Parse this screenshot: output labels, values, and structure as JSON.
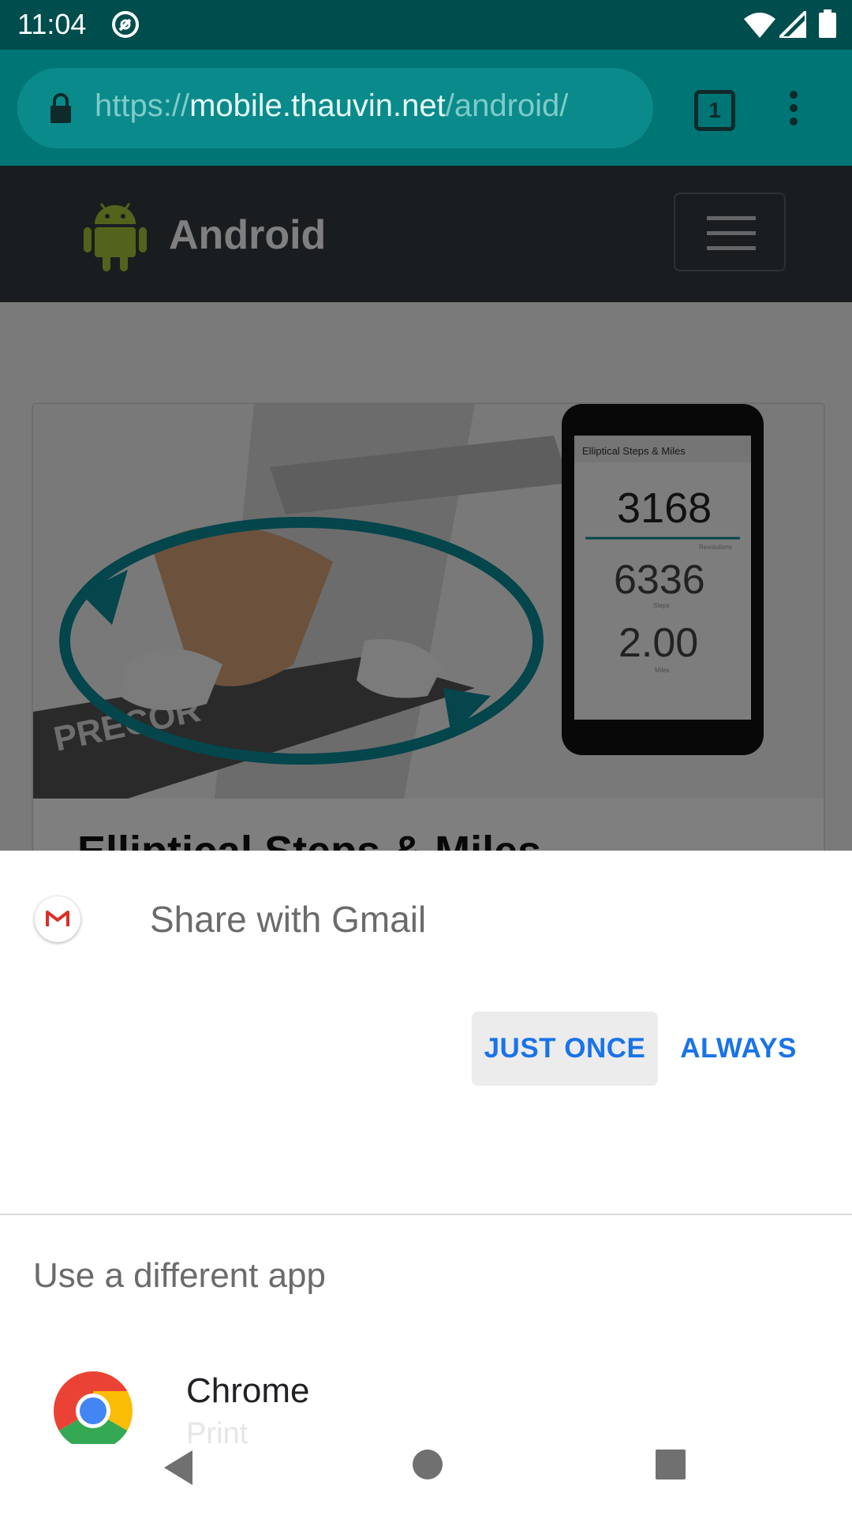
{
  "status_bar": {
    "time": "11:04",
    "icons": [
      "notification-icon",
      "wifi-icon",
      "signal-icon",
      "battery-icon"
    ]
  },
  "browser": {
    "url_prefix": "https://",
    "url_host": "mobile.thauvin.net",
    "url_path": "/android/",
    "tab_count": "1"
  },
  "website": {
    "title": "Android",
    "card_title": "Elliptical Steps & Miles",
    "card_image_phone": {
      "header": "Elliptical Steps & Miles",
      "rev": "3168",
      "steps": "6336",
      "miles": "2.00",
      "rev_label": "Revolutions",
      "steps_label": "Steps",
      "miles_label": "Miles"
    },
    "treadmill_brand": "PRECOR"
  },
  "share_sheet": {
    "title": "Share with Gmail",
    "just_once": "JUST ONCE",
    "always": "ALWAYS",
    "different_app": "Use a different app",
    "apps": [
      {
        "label": "Chrome",
        "sub": "Print"
      }
    ]
  },
  "colors": {
    "accent": "#1a73e8",
    "status_bar": "#004d4d",
    "toolbar": "#007575"
  }
}
